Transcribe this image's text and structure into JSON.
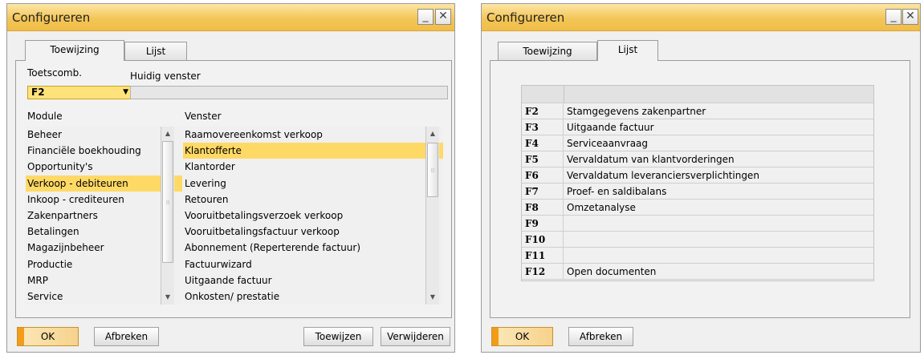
{
  "win1": {
    "title": "Configureren",
    "tabs": [
      "Toewijzing",
      "Lijst"
    ],
    "toetscomb_label": "Toetscomb.",
    "huidig_label": "Huidig venster",
    "combo_value": "F2",
    "module_header": "Module",
    "venster_header": "Venster",
    "modules": [
      "Beheer",
      "Financiële boekhouding",
      "Opportunity's",
      "Verkoop - debiteuren",
      "Inkoop - crediteuren",
      "Zakenpartners",
      "Betalingen",
      "Magazijnbeheer",
      "Productie",
      "MRP",
      "Service"
    ],
    "module_selected": 3,
    "vensters": [
      "Raamovereenkomst verkoop",
      "Klantofferte",
      "Klantorder",
      "Levering",
      "Retouren",
      "Vooruitbetalingsverzoek verkoop",
      "Vooruitbetalingsfactuur verkoop",
      "Abonnement (Reperterende factuur)",
      "Factuurwizard",
      "Uitgaande factuur",
      "Onkosten/ prestatie"
    ],
    "venster_selected": 1,
    "buttons": {
      "ok": "OK",
      "cancel": "Afbreken",
      "assign": "Toewijzen",
      "remove": "Verwijderen"
    }
  },
  "win2": {
    "title": "Configureren",
    "tabs": [
      "Toewijzing",
      "Lijst"
    ],
    "rows": [
      {
        "key": "F2",
        "value": "Stamgegevens zakenpartner"
      },
      {
        "key": "F3",
        "value": "Uitgaande factuur"
      },
      {
        "key": "F4",
        "value": "Serviceaanvraag"
      },
      {
        "key": "F5",
        "value": "Vervaldatum van klantvorderingen"
      },
      {
        "key": "F6",
        "value": "Vervaldatum leveranciersverplichtingen"
      },
      {
        "key": "F7",
        "value": "Proef- en saldibalans"
      },
      {
        "key": "F8",
        "value": "Omzetanalyse"
      },
      {
        "key": "F9",
        "value": ""
      },
      {
        "key": "F10",
        "value": ""
      },
      {
        "key": "F11",
        "value": ""
      },
      {
        "key": "F12",
        "value": "Open documenten"
      }
    ],
    "buttons": {
      "ok": "OK",
      "cancel": "Afbreken"
    }
  },
  "colors": {
    "titlebar": "#f3c658",
    "selection": "#ffd966",
    "combo": "#ffe37a",
    "ok_accent": "#f39c1a"
  }
}
